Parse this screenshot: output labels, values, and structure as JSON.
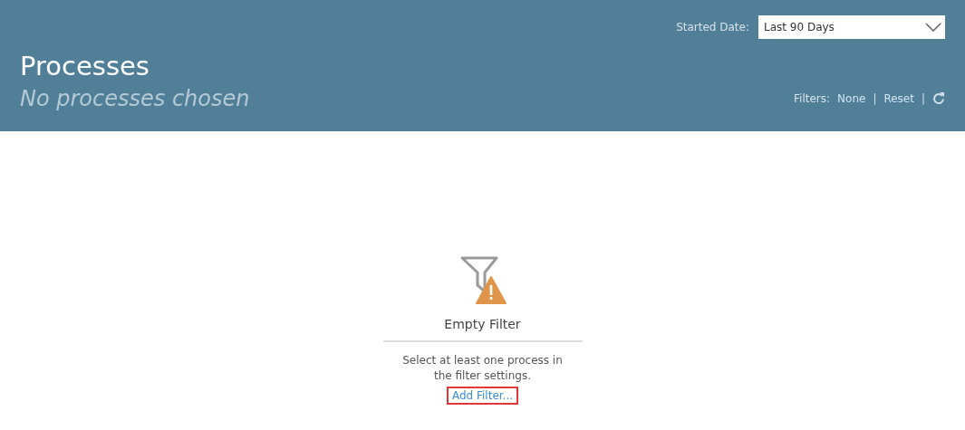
{
  "header": {
    "title": "Processes",
    "subtitle": "No processes chosen",
    "date_filter": {
      "label": "Started Date:",
      "value": "Last 90 Days"
    },
    "filters": {
      "label": "Filters:",
      "value": "None",
      "separator": "|",
      "reset": "Reset"
    }
  },
  "empty_state": {
    "title": "Empty Filter",
    "message": "Select at least one process in the filter settings.",
    "link": "Add Filter...",
    "highlighted": true
  }
}
